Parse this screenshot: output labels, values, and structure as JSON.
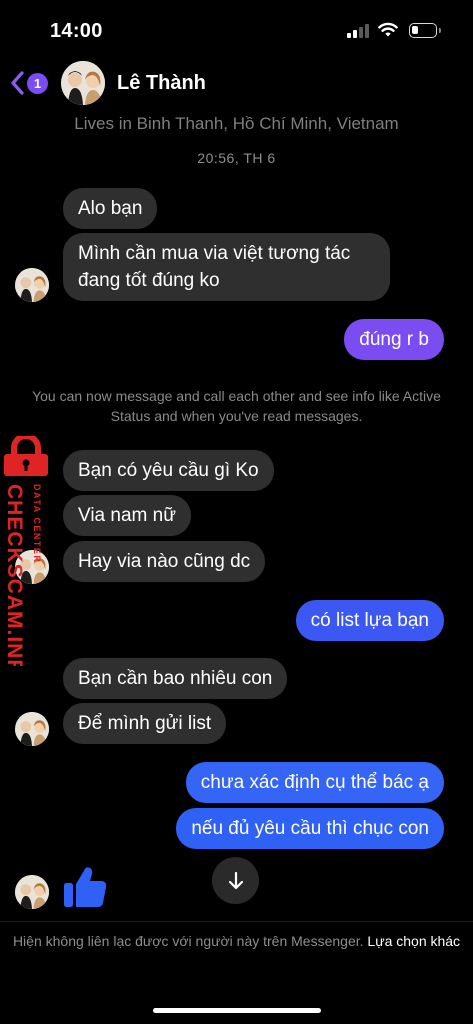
{
  "status_bar": {
    "time": "14:00"
  },
  "header": {
    "unread_count": "1",
    "contact_name": "Lê Thành",
    "lives_in": "Lives in Binh Thanh, Hồ Chí Minh, Vietnam"
  },
  "thread": {
    "timestamp": "20:56, TH 6",
    "messages": [
      {
        "dir": "in",
        "text": "Alo bạn"
      },
      {
        "dir": "in",
        "text": "Mình cần mua via việt tương tác đang tốt đúng ko"
      },
      {
        "dir": "out",
        "text": "đúng r b"
      },
      {
        "dir": "in",
        "text": "Bạn có yêu cầu gì Ko"
      },
      {
        "dir": "in",
        "text": "Via nam nữ"
      },
      {
        "dir": "in",
        "text": "Hay via nào cũng dc"
      },
      {
        "dir": "out",
        "text": "có list lựa bạn"
      },
      {
        "dir": "in",
        "text": "Bạn cần bao nhiêu con"
      },
      {
        "dir": "in",
        "text": "Để mình gửi list"
      },
      {
        "dir": "out",
        "text": "chưa xác định cụ thể bác ạ"
      },
      {
        "dir": "out",
        "text": "nếu đủ yêu cầu thì chục con"
      }
    ],
    "notice": "You can now message and call each other and see info like Active Status and when you've read messages."
  },
  "watermark": {
    "brand": "CHECKSCAM.INFO",
    "tagline": "DATA CENTER"
  },
  "footer": {
    "text": "Hiện không liên lạc được với người này trên Messenger.",
    "link": "Lựa chọn khác"
  },
  "colors": {
    "accent_purple": "#7b4cf2",
    "incoming_bubble": "#2f2f2f",
    "outgoing_top": "#7b4cf2",
    "outgoing_bottom": "#2f62f4",
    "like_blue": "#2f62f4"
  },
  "icons": [
    "chevron-left-icon",
    "thumbs-up-icon",
    "arrow-down-icon",
    "signal-icon",
    "wifi-icon",
    "battery-icon",
    "lock-icon"
  ]
}
